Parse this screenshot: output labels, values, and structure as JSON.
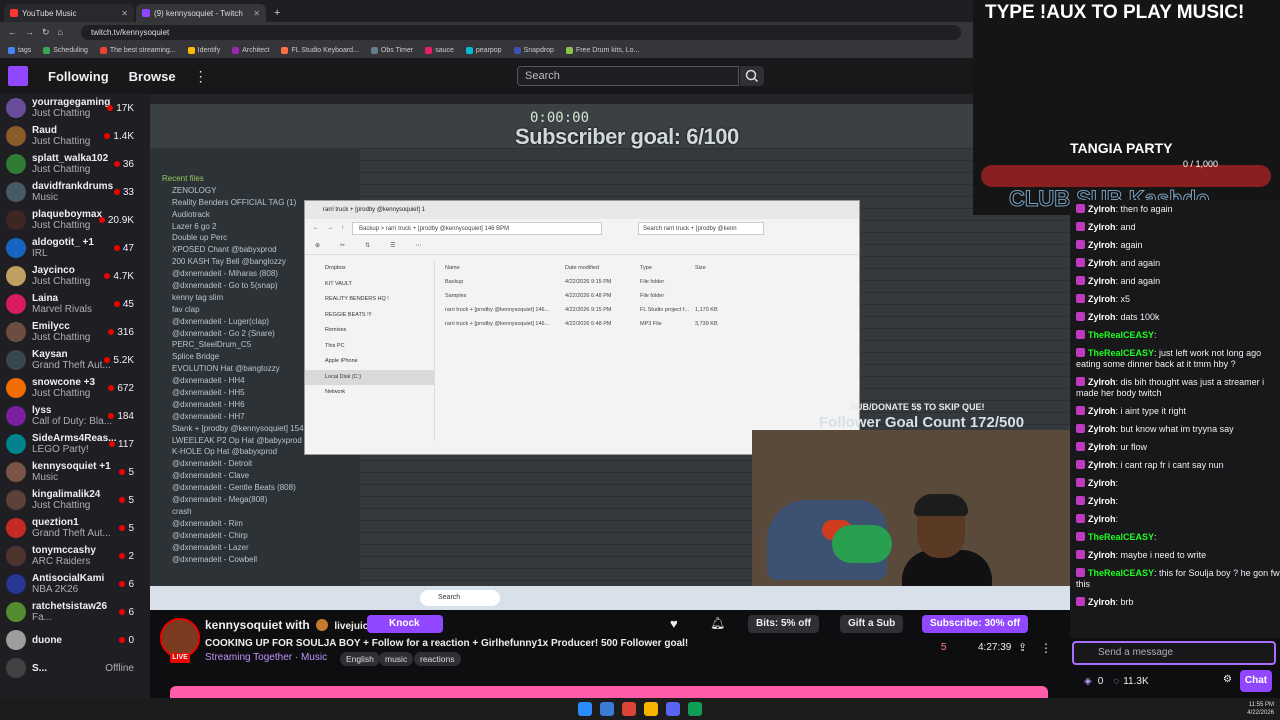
{
  "browser": {
    "tabs": [
      {
        "title": "YouTube Music",
        "fav": "youtube"
      },
      {
        "title": "(9) kennysoquiet - Twitch",
        "fav": "twitch"
      }
    ],
    "url": "twitch.tv/kennysoquiet",
    "bookmarks": [
      "tags",
      "Scheduling",
      "The best streaming...",
      "Identify",
      "Architect",
      "FL Studio Keyboard...",
      "Obs Timer",
      "sauce",
      "pearpop",
      "Snapdrop",
      "Free Drum kits, Lo..."
    ]
  },
  "nav": {
    "following": "Following",
    "browse": "Browse",
    "search_placeholder": "Search"
  },
  "sidebar": [
    {
      "name": "yourragegaming",
      "game": "Just Chatting",
      "viewers": "17K",
      "color": "#6a4c9c"
    },
    {
      "name": "Raud",
      "game": "Just Chatting",
      "viewers": "1.4K",
      "color": "#8b5a2b"
    },
    {
      "name": "splatt_walka102",
      "game": "Just Chatting",
      "viewers": "36",
      "color": "#2e7d32"
    },
    {
      "name": "davidfrankdrums",
      "game": "Music",
      "viewers": "33",
      "color": "#455a64"
    },
    {
      "name": "plaqueboymax",
      "game": "Just Chatting",
      "viewers": "20.9K",
      "color": "#3e2723"
    },
    {
      "name": "aldogotit_ +1",
      "game": "IRL",
      "viewers": "47",
      "color": "#1565c0"
    },
    {
      "name": "Jaycinco",
      "game": "Just Chatting",
      "viewers": "4.7K",
      "color": "#c0a060"
    },
    {
      "name": "Laina",
      "game": "Marvel Rivals",
      "viewers": "45",
      "color": "#d81b60"
    },
    {
      "name": "Emilycc",
      "game": "Just Chatting",
      "viewers": "316",
      "color": "#6d4c41"
    },
    {
      "name": "Kaysan",
      "game": "Grand Theft Aut...",
      "viewers": "5.2K",
      "color": "#37474f"
    },
    {
      "name": "snowcone +3",
      "game": "Just Chatting",
      "viewers": "672",
      "color": "#ef6c00"
    },
    {
      "name": "lyss",
      "game": "Call of Duty: Bla...",
      "viewers": "184",
      "color": "#7b1fa2"
    },
    {
      "name": "SideArms4Reas...",
      "game": "LEGO Party!",
      "viewers": "117",
      "color": "#00838f"
    },
    {
      "name": "kennysoquiet +1",
      "game": "Music",
      "viewers": "5",
      "color": "#795548"
    },
    {
      "name": "kingalimalik24",
      "game": "Just Chatting",
      "viewers": "5",
      "color": "#5d4037"
    },
    {
      "name": "queztion1",
      "game": "Grand Theft Aut...",
      "viewers": "5",
      "color": "#c62828"
    },
    {
      "name": "tonymccashy",
      "game": "ARC Raiders",
      "viewers": "2",
      "color": "#4e342e"
    },
    {
      "name": "AntisocialKami",
      "game": "NBA 2K26",
      "viewers": "6",
      "color": "#283593"
    },
    {
      "name": "ratchetsistaw26",
      "game": "Fa...",
      "viewers": "6",
      "color": "#558b2f"
    },
    {
      "name": "duone",
      "game": "",
      "viewers": "0",
      "color": "#9e9e9e"
    },
    {
      "name": "S...",
      "game": "",
      "viewers": "Offline",
      "color": "#424242",
      "offline": true
    }
  ],
  "fl": {
    "browser_header": "Recent files",
    "files": [
      "ZENOLOGY",
      "Reality Benders OFFICIAL TAG (1)",
      "Audiotrack",
      "Lazer 6 go 2",
      "Double up Perc",
      "XPOSED Chant @babyxprod",
      "200 KASH Tay Bell @banglozzy",
      "@dxnemadeit - Miharas (808)",
      "@dxnemadeit - Go to 5(snap)",
      "kenny tag slim",
      "fav clap",
      "@dxnemadeit - Luger(clap)",
      "@dxnemadeit - Go 2 (Snare)",
      "PERC_SteelDrum_C5",
      "Splice Bridge",
      "EVOLUTION Hat @bangtozzy",
      "@dxnemadeit - HH4",
      "@dxnemadeit - HH5",
      "@dxnemadeit - HH6",
      "@dxnemadeit - HH7",
      "Stank + [prodby @kennysoquiet] 154 B",
      "LWEELEAK P2 Op Hat @babyxprod",
      "K-HOLE Op Hat @babyxprod",
      "@dxnemadeit - Detroit",
      "@dxnemadeit - Clave",
      "@dxnemadeit - Gentle Beats (808)",
      "@dxnemadeit - Mega(808)",
      "crash",
      "@dxnemadeit - Rim",
      "@dxnemadeit - Chirp",
      "@dxnemadeit - Lazer",
      "@dxnemadeit - Cowbell"
    ],
    "time": "0:00:00"
  },
  "explorer": {
    "title": "rarri truck + [prodby @kennysoquiet] 1",
    "crumb": "Backup  >  rarri truck + [prodby @kennysoquiet] 146 BPM",
    "search": "Search rarri truck + [prodby @kenn",
    "nav": [
      "Dropbox",
      "KIT VAULT",
      "REALITY BENDERS HQ !",
      "REGGIE BEATS !!!",
      "Remixes",
      "This PC",
      "Apple iPhone",
      "Local Disk (C:)",
      "Network"
    ],
    "headers": [
      "Name",
      "Date modified",
      "Type",
      "Size"
    ],
    "rows": [
      [
        "Backup",
        "4/22/2026 9:15 PM",
        "File folder",
        ""
      ],
      [
        "Samples",
        "4/22/2026 6:48 PM",
        "File folder",
        ""
      ],
      [
        "rarri truck + [prodby @kennysoquiet] 146...",
        "4/22/2026 9:15 PM",
        "FL Studio project f...",
        "1,170 KB"
      ],
      [
        "rarri truck + [prodby @kennysoquiet] 146...",
        "4/22/2026 6:48 PM",
        "MP3 File",
        "3,739 KB"
      ]
    ]
  },
  "overlay": {
    "subscriber_goal": "Subscriber goal: 6/100",
    "skip": "SUB/DONATE 5$ TO SKIP QUE!",
    "follower_goal": "Follower Goal Count 172/500",
    "aux": "TYPE !AUX TO PLAY MUSIC!",
    "party": "TANGIA PARTY",
    "party_count": "0 / 1,000",
    "club": "CLUB SUB Kashdo"
  },
  "chat": [
    {
      "user": "Zylroh",
      "text": "then fo again",
      "color": "#ffffff"
    },
    {
      "user": "Zylroh",
      "text": "and",
      "color": "#ffffff"
    },
    {
      "user": "Zylroh",
      "text": "again",
      "color": "#ffffff"
    },
    {
      "user": "Zylroh",
      "text": "and again",
      "color": "#ffffff"
    },
    {
      "user": "Zylroh",
      "text": "and again",
      "color": "#ffffff"
    },
    {
      "user": "Zylroh",
      "text": "x5",
      "color": "#ffffff"
    },
    {
      "user": "Zylroh",
      "text": "dats 100k",
      "color": "#ffffff"
    },
    {
      "user": "TheRealCEASY",
      "text": "",
      "color": "#1eff1e"
    },
    {
      "user": "TheRealCEASY",
      "text": "just left work not long ago eating some dinner back at it tmm hby ?",
      "color": "#1eff1e"
    },
    {
      "user": "Zylroh",
      "text": "dis bih thought was just a streamer i made her body twitch",
      "color": "#ffffff"
    },
    {
      "user": "Zylroh",
      "text": "i aint type it right",
      "color": "#ffffff"
    },
    {
      "user": "Zylroh",
      "text": "but know what im tryyna say",
      "color": "#ffffff"
    },
    {
      "user": "Zylroh",
      "text": "ur flow",
      "color": "#ffffff"
    },
    {
      "user": "Zylroh",
      "text": "i cant rap fr i cant say nun",
      "color": "#ffffff"
    },
    {
      "user": "Zylroh",
      "text": "",
      "color": "#ffffff"
    },
    {
      "user": "Zylroh",
      "text": "",
      "color": "#ffffff"
    },
    {
      "user": "Zylroh",
      "text": "",
      "color": "#ffffff"
    },
    {
      "user": "TheRealCEASY",
      "text": "",
      "color": "#1eff1e"
    },
    {
      "user": "Zylroh",
      "text": "maybe i need to write",
      "color": "#ffffff"
    },
    {
      "user": "TheRealCEASY",
      "text": "this for Soulja boy ? he gon fw this",
      "color": "#1eff1e"
    },
    {
      "user": "Zylroh",
      "text": "brb",
      "color": "#ffffff"
    }
  ],
  "chat_input": {
    "placeholder": "Send a message",
    "points": "0",
    "bits": "11.3K",
    "chat_button": "Chat"
  },
  "stream": {
    "streamer": "kennysoquiet with",
    "collab": "livejuicetv",
    "knock": "Knock",
    "title": "COOKING UP FOR SOULJA BOY + Follow for a reaction + Girlhefunny1x Producer! 500 Follower goal!",
    "category": "Streaming Together · Music",
    "tags": [
      "English",
      "music",
      "reactions"
    ],
    "bits": "Bits: 5% off",
    "gift": "Gift a Sub",
    "subscribe": "Subscribe: 30% off",
    "viewers": "5",
    "uptime": "4:27:39",
    "live": "LIVE"
  },
  "taskbar": {
    "time": "11:55 PM",
    "date": "4/22/2026"
  }
}
